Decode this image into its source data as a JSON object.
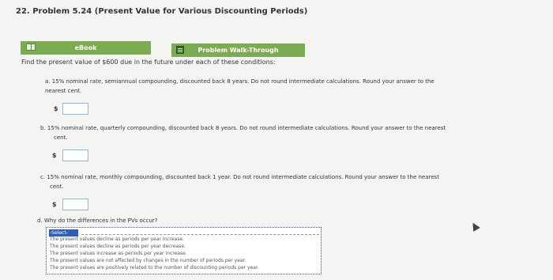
{
  "header": {
    "title": "22. Problem 5.24 (Present Value for Various Discounting Periods)"
  },
  "toolbar": {
    "ebook_label": "eBook",
    "walkthrough_label": "Problem Walk-Through"
  },
  "problem": {
    "intro": "Find the present value of $600 due in the future under each of these conditions:",
    "parts": [
      {
        "label": "a.",
        "text": "15% nominal rate, semiannual compounding, discounted back 8 years. Do not round intermediate calculations. Round your answer to the nearest cent.",
        "line1": "15% nominal rate, semiannual compounding, discounted back 8 years. Do not round intermediate calculations. Round your answer to the",
        "line2": "nearest cent.",
        "currency": "$",
        "value": ""
      },
      {
        "label": "b.",
        "text": "15% nominal rate, quarterly compounding, discounted back 8 years. Do not round intermediate calculations. Round your answer to the nearest cent.",
        "line1": "15% nominal rate, quarterly compounding, discounted back 8 years. Do not round intermediate calculations. Round your answer to the nearest",
        "line2": "cent.",
        "currency": "$",
        "value": ""
      },
      {
        "label": "c.",
        "text": "15% nominal rate, monthly compounding, discounted back 1 year. Do not round intermediate calculations. Round your answer to the nearest cent.",
        "line1": "15% nominal rate, monthly compounding, discounted back 1 year. Do not round intermediate calculations. Round your answer to the nearest",
        "line2": "cent.",
        "currency": "$",
        "value": ""
      }
    ],
    "question_d": {
      "label": "d.",
      "text": "Why do the differences in the PVs occur?",
      "selected": "-Select-",
      "options": [
        "The present values decline as periods per year increase.",
        "The present values decline as periods per year decrease.",
        "The present values increase as periods per year increase.",
        "The present values are not affected by changes in the number of periods per year.",
        "The present values are positively related to the number of discounting periods per year."
      ]
    }
  }
}
